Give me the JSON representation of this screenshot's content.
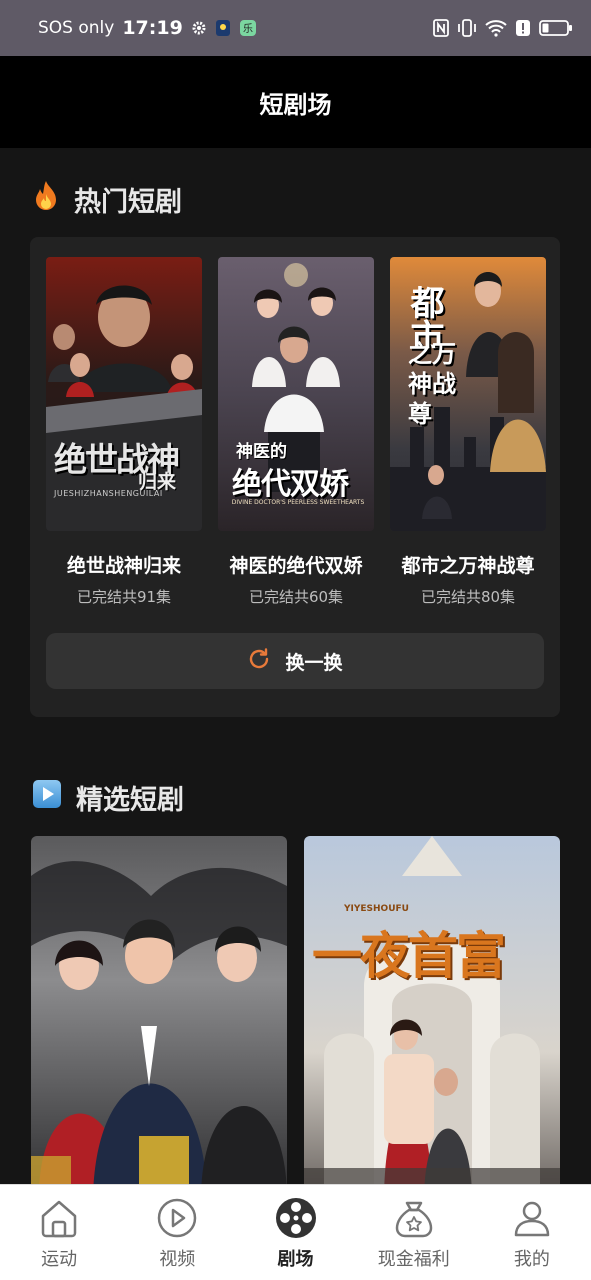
{
  "status_bar": {
    "carrier": "SOS only",
    "time": "17:19",
    "icons": [
      "gear-icon",
      "notification-app-icon",
      "notification-app-icon-2",
      "nfc-icon",
      "vibrate-icon",
      "wifi-icon",
      "alert-icon",
      "battery-icon"
    ]
  },
  "header": {
    "title": "短剧场"
  },
  "hot_section": {
    "title": "热门短剧",
    "icon": "fire-icon",
    "dramas": [
      {
        "name": "绝世战神归来",
        "meta": "已完结共91集",
        "poster_text": "绝世战神",
        "poster_sub": "归来",
        "poster_caption": "JUESHIZHANSHENGUILAI"
      },
      {
        "name": "神医的绝代双娇",
        "meta": "已完结共60集",
        "poster_text": "绝代双娇",
        "poster_sub": "神医的",
        "poster_caption": "DIVINE DOCTOR'S PEERLESS SWEETHEARTS"
      },
      {
        "name": "都市之万神战尊",
        "meta": "已完结共80集",
        "poster_text": "都市",
        "poster_sub": "之万神战尊",
        "poster_caption": ""
      }
    ],
    "refresh_label": "换一换",
    "refresh_icon": "refresh-icon"
  },
  "featured_section": {
    "title": "精选短剧",
    "icon": "play-icon",
    "items": [
      {
        "poster_text": ""
      },
      {
        "poster_text": "一夜首富",
        "poster_caption": "YIYESHOUFU"
      }
    ]
  },
  "bottom_nav": {
    "items": [
      {
        "label": "运动",
        "icon": "home-icon"
      },
      {
        "label": "视频",
        "icon": "play-circle-icon"
      },
      {
        "label": "剧场",
        "icon": "film-reel-icon",
        "active": true
      },
      {
        "label": "现金福利",
        "icon": "money-bag-icon"
      },
      {
        "label": "我的",
        "icon": "profile-icon"
      }
    ]
  },
  "colors": {
    "accent": "#e87a3a",
    "background": "#151515",
    "panel": "#222222",
    "nav_active": "#222222"
  }
}
